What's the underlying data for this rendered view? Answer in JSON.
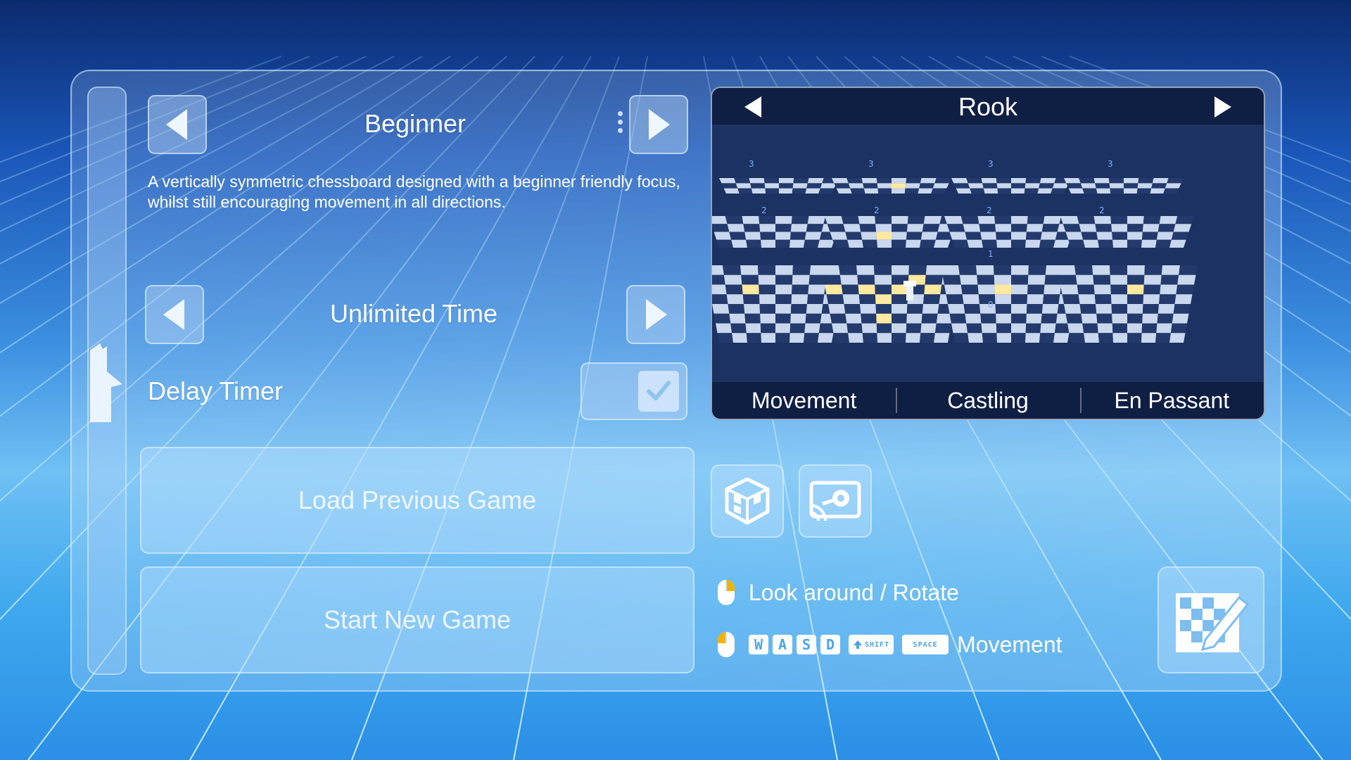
{
  "board_selector": {
    "title": "Beginner",
    "description": "A vertically symmetric chessboard designed with a beginner friendly focus, whilst still encouraging movement in all directions."
  },
  "time_selector": {
    "label": "Unlimited Time"
  },
  "delay_timer": {
    "label": "Delay Timer",
    "enabled": true
  },
  "buttons": {
    "load_previous": "Load Previous Game",
    "start_new": "Start New Game"
  },
  "piece_preview": {
    "piece_name": "Rook",
    "tabs": [
      "Movement",
      "Castling",
      "En Passant"
    ],
    "level_labels": [
      "3",
      "3",
      "3",
      "3",
      "2",
      "2",
      "2",
      "2",
      "1",
      "0"
    ]
  },
  "controls": {
    "look_label": "Look around / Rotate",
    "move_keys": [
      "W",
      "A",
      "S",
      "D"
    ],
    "shift_key": "SHIFT",
    "space_key": "SPACE",
    "move_label": "Movement"
  },
  "colors": {
    "accent": "#4aa5ea",
    "mouse_highlight": "#f0b400",
    "tile_highlight": "#ffe9a0"
  }
}
